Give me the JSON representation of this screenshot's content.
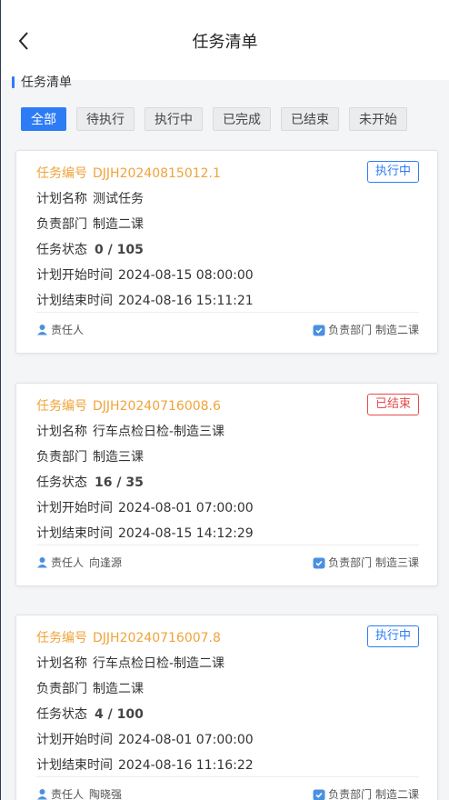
{
  "header": {
    "title": "任务清单"
  },
  "section": {
    "title": "任务清单"
  },
  "filters": [
    "全部",
    "待执行",
    "执行中",
    "已完成",
    "已结束",
    "未开始"
  ],
  "labels": {
    "task_no": "任务编号",
    "plan_name": "计划名称",
    "dept": "负责部门",
    "status": "任务状态",
    "start": "计划开始时间",
    "end": "计划结束时间",
    "owner": "责任人",
    "dept_footer": "负责部门"
  },
  "tasks": [
    {
      "no": "DJJH20240815012.1",
      "tag": "执行中",
      "name": "测试任务",
      "dept": "制造二课",
      "progress": "0 / 105",
      "start": "2024-08-15 08:00:00",
      "end": "2024-08-16 15:11:21",
      "owner": ""
    },
    {
      "no": "DJJH20240716008.6",
      "tag": "已结束",
      "name": "行车点检日检-制造三课",
      "dept": "制造三课",
      "progress": "16 / 35",
      "start": "2024-08-01 07:00:00",
      "end": "2024-08-15 14:12:29",
      "owner": "向逢源"
    },
    {
      "no": "DJJH20240716007.8",
      "tag": "执行中",
      "name": "行车点检日检-制造二课",
      "dept": "制造二课",
      "progress": "4 / 100",
      "start": "2024-08-01 07:00:00",
      "end": "2024-08-16 11:16:22",
      "owner": "陶晓强"
    }
  ],
  "colors": {
    "accent": "#2d7cf6",
    "task_no": "#f0a33a",
    "ended": "#e54a4a"
  }
}
